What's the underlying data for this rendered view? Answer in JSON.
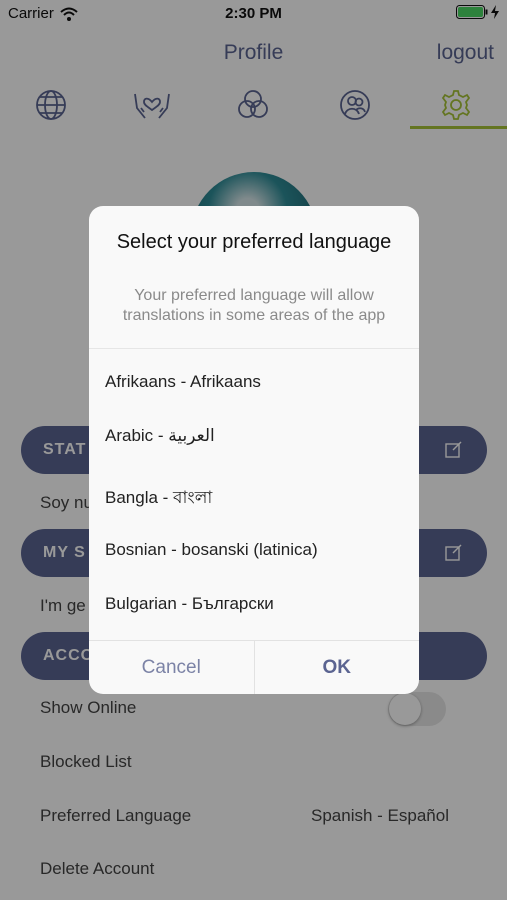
{
  "status_bar": {
    "carrier": "Carrier",
    "time": "2:30 PM"
  },
  "header": {
    "title": "Profile",
    "logout": "logout"
  },
  "tabs": [
    {
      "icon": "globe-icon",
      "active": false
    },
    {
      "icon": "hands-heart-icon",
      "active": false
    },
    {
      "icon": "circles-icon",
      "active": false
    },
    {
      "icon": "user-circle-icon",
      "active": false
    },
    {
      "icon": "gear-icon",
      "active": true
    }
  ],
  "sections": {
    "status": {
      "label": "STAT"
    },
    "status_text": "Soy nu",
    "my": {
      "label": "MY S"
    },
    "my_text": "I'm ge",
    "account": {
      "label": "ACCO"
    }
  },
  "settings": {
    "show_online": "Show Online",
    "blocked_list": "Blocked List",
    "preferred_language": "Preferred Language",
    "preferred_language_value": "Spanish - Español",
    "delete_account": "Delete Account"
  },
  "dialog": {
    "title": "Select your preferred language",
    "message": "Your preferred language will allow translations in some areas of the app",
    "languages": [
      "Afrikaans - Afrikaans",
      "Arabic - العربية",
      "Bangla - বাংলা",
      "Bosnian - bosanski (latinica)",
      "Bulgarian - Български"
    ],
    "cancel": "Cancel",
    "ok": "OK"
  },
  "colors": {
    "accent": "#5b6491",
    "active_tab": "#a7c438"
  }
}
